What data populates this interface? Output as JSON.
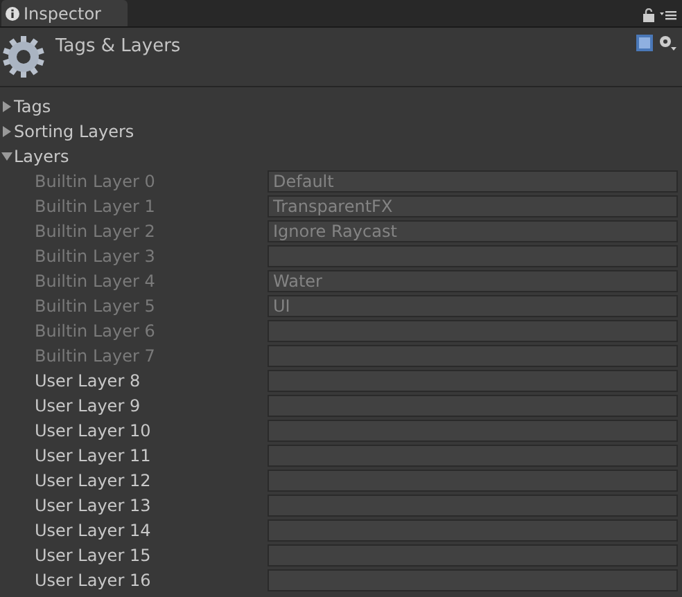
{
  "tab": {
    "label": "Inspector",
    "selected": true
  },
  "header": {
    "title": "Tags & Layers"
  },
  "sections": [
    {
      "label": "Tags",
      "expanded": false
    },
    {
      "label": "Sorting Layers",
      "expanded": false
    },
    {
      "label": "Layers",
      "expanded": true
    }
  ],
  "layers": [
    {
      "label": "Builtin Layer 0",
      "value": "Default",
      "disabled": true
    },
    {
      "label": "Builtin Layer 1",
      "value": "TransparentFX",
      "disabled": true
    },
    {
      "label": "Builtin Layer 2",
      "value": "Ignore Raycast",
      "disabled": true
    },
    {
      "label": "Builtin Layer 3",
      "disabled": true
    },
    {
      "label": "Builtin Layer 4",
      "value": "Water",
      "disabled": true
    },
    {
      "label": "Builtin Layer 5",
      "value": "UI",
      "disabled": true
    },
    {
      "label": "Builtin Layer 6",
      "disabled": true
    },
    {
      "label": "Builtin Layer 7",
      "disabled": true
    },
    {
      "label": "User Layer 8",
      "disabled": false
    },
    {
      "label": "User Layer 9",
      "disabled": false
    },
    {
      "label": "User Layer 10",
      "disabled": false
    },
    {
      "label": "User Layer 11",
      "disabled": false
    },
    {
      "label": "User Layer 12",
      "disabled": false
    },
    {
      "label": "User Layer 13",
      "disabled": false
    },
    {
      "label": "User Layer 14",
      "disabled": false
    },
    {
      "label": "User Layer 15",
      "disabled": false
    },
    {
      "label": "User Layer 16",
      "disabled": false
    }
  ]
}
